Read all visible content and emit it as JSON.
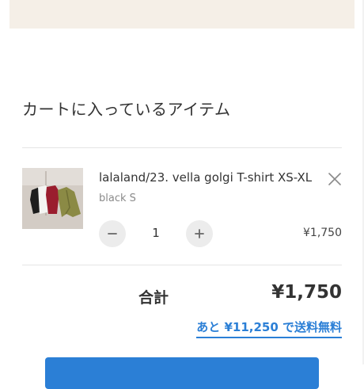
{
  "cart": {
    "title": "カートに入っているアイテム"
  },
  "item": {
    "name": "lalaland/23. vella golgi T-shirt XS-XL",
    "variant": "black S",
    "quantity": "1",
    "price": "¥1,750",
    "thumbnail_icon": "product-photo"
  },
  "icons": {
    "remove": "close-icon",
    "decrease": "minus-icon",
    "increase": "plus-icon"
  },
  "summary": {
    "total_label": "合計",
    "total_amount": "¥1,750",
    "free_shipping_notice": "あと ¥11,250 で送料無料"
  },
  "colors": {
    "accent": "#2b7fd6",
    "banner": "#f5efe7",
    "text": "#333333",
    "muted": "#8a8a8a",
    "qty_button": "#ececec"
  }
}
